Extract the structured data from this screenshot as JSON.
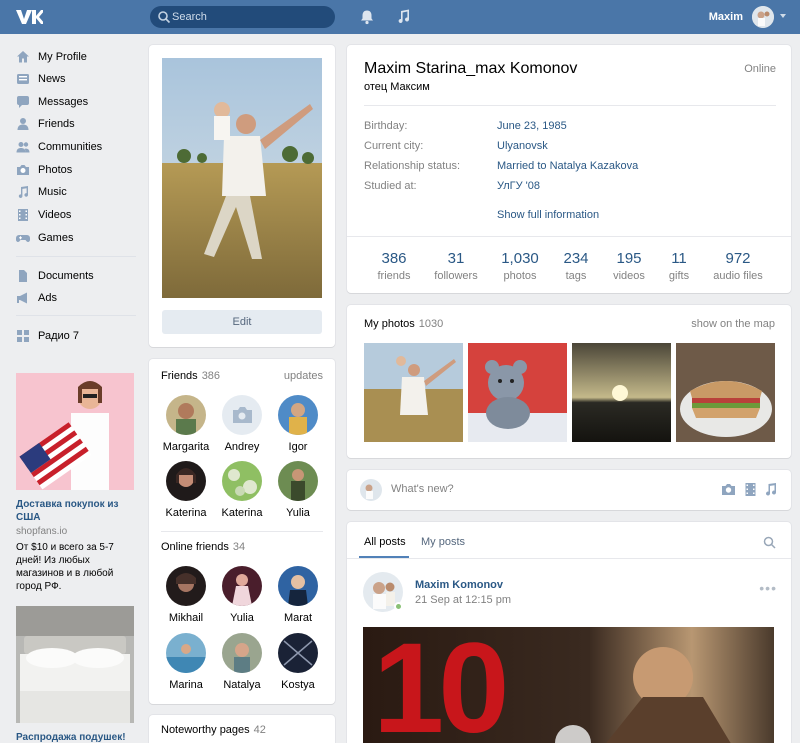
{
  "header": {
    "logo_text": "VK",
    "search_placeholder": "Search",
    "user_name": "Maxim"
  },
  "nav": {
    "items": [
      {
        "label": "My Profile",
        "icon": "home-icon"
      },
      {
        "label": "News",
        "icon": "news-icon"
      },
      {
        "label": "Messages",
        "icon": "messages-icon"
      },
      {
        "label": "Friends",
        "icon": "friends-icon"
      },
      {
        "label": "Communities",
        "icon": "communities-icon"
      },
      {
        "label": "Photos",
        "icon": "camera-icon"
      },
      {
        "label": "Music",
        "icon": "music-icon"
      },
      {
        "label": "Videos",
        "icon": "film-icon"
      },
      {
        "label": "Games",
        "icon": "gamepad-icon"
      },
      {
        "label": "Documents",
        "icon": "document-icon"
      },
      {
        "label": "Ads",
        "icon": "megaphone-icon"
      },
      {
        "label": "Радио 7",
        "icon": "apps-grid-icon"
      }
    ]
  },
  "ads": [
    {
      "title": "Доставка покупок из США",
      "domain": "shopfans.io",
      "text": "От $10 и всего за 5-7 дней! Из любых магазинов и в любой город РФ."
    },
    {
      "title": "Распродажа подушек!",
      "domain": "",
      "text": ""
    }
  ],
  "profile": {
    "edit_label": "Edit",
    "name": "Maxim Starina_max Komonov",
    "status": "отец Максим",
    "online": "Online",
    "info": [
      {
        "key": "Birthday:",
        "value": "June 23, 1985"
      },
      {
        "key": "Current city:",
        "value": "Ulyanovsk"
      },
      {
        "key": "Relationship status:",
        "value": "Married to Natalya Kazakova"
      },
      {
        "key": "Studied at:",
        "value": "УлГУ '08"
      }
    ],
    "show_full": "Show full information",
    "counters": [
      {
        "n": "386",
        "l": "friends"
      },
      {
        "n": "31",
        "l": "followers"
      },
      {
        "n": "1,030",
        "l": "photos"
      },
      {
        "n": "234",
        "l": "tags"
      },
      {
        "n": "195",
        "l": "videos"
      },
      {
        "n": "11",
        "l": "gifts"
      },
      {
        "n": "972",
        "l": "audio files"
      }
    ]
  },
  "friends": {
    "title": "Friends",
    "count": "386",
    "right": "updates",
    "list": [
      "Margarita",
      "Andrey",
      "Igor",
      "Katerina",
      "Katerina",
      "Yulia"
    ],
    "online_title": "Online friends",
    "online_count": "34",
    "online_list": [
      "Mikhail",
      "Yulia",
      "Marat",
      "Marina",
      "Natalya",
      "Kostya"
    ],
    "noteworthy_title": "Noteworthy pages",
    "noteworthy_count": "42"
  },
  "photos": {
    "title": "My photos",
    "count": "1030",
    "right": "show on the map"
  },
  "composer": {
    "placeholder": "What's new?"
  },
  "posts": {
    "tabs": [
      "All posts",
      "My posts"
    ],
    "author": "Maxim Komonov",
    "date": "21 Sep at 12:15 pm",
    "more": "•••",
    "video_text": "10"
  }
}
